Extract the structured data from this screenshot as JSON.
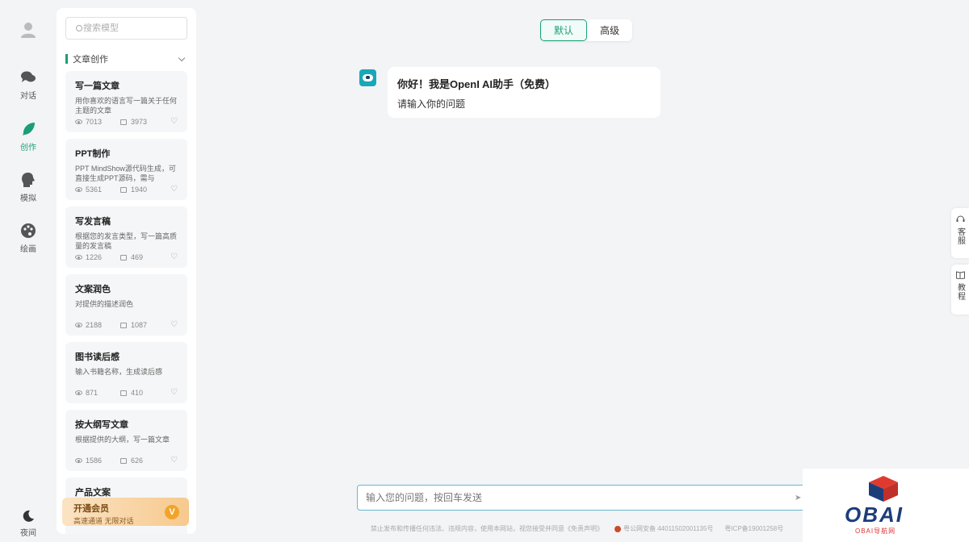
{
  "rail": {
    "items": [
      {
        "label": "对话",
        "icon": "chat-icon"
      },
      {
        "label": "创作",
        "icon": "feather-icon",
        "active": true
      },
      {
        "label": "模拟",
        "icon": "head-icon"
      },
      {
        "label": "绘画",
        "icon": "palette-icon"
      }
    ],
    "night_label": "夜间"
  },
  "sidebar": {
    "search_placeholder": "搜索模型",
    "category": "文章创作",
    "cards": [
      {
        "title": "写一篇文章",
        "desc": "用你喜欢的语言写一篇关于任何主题的文章",
        "views": "7013",
        "comments": "3973"
      },
      {
        "title": "PPT制作",
        "desc": "PPT MindShow源代码生成，可直接生成PPT源码，需与MindShow",
        "views": "5361",
        "comments": "1940"
      },
      {
        "title": "写发言稿",
        "desc": "根据您的发言类型，写一篇高质量的发言稿",
        "views": "1226",
        "comments": "469"
      },
      {
        "title": "文案润色",
        "desc": "对提供的描述润色",
        "views": "2188",
        "comments": "1087"
      },
      {
        "title": "图书读后感",
        "desc": "输入书籍名称，生成读后感",
        "views": "871",
        "comments": "410"
      },
      {
        "title": "按大纲写文章",
        "desc": "根据提供的大纲，写一篇文章",
        "views": "1586",
        "comments": "626"
      },
      {
        "title": "产品文案",
        "desc": "",
        "views": "",
        "comments": ""
      }
    ],
    "vip": {
      "title": "开通会员",
      "subtitle": "高速通道 无限对话",
      "badge": "V"
    }
  },
  "mode": {
    "default": "默认",
    "advanced": "高级"
  },
  "chat": {
    "greeting": "你好！我是OpenI AI助手（免费）",
    "prompt": "请输入你的问题"
  },
  "float": {
    "service": "客服",
    "tutorial": "教程"
  },
  "input": {
    "placeholder": "输入您的问题，按回车发送"
  },
  "footer": {
    "notice": "禁止发布和传播任何违法、违规内容，使用本网站，视您接受并同意《免责声明》",
    "police": "粤公网安备 44011502001135号",
    "icp": "粤ICP备19001258号"
  },
  "watermark": {
    "brand": "OBAI",
    "sub": "OBAI导航网"
  },
  "colors": {
    "accent": "#1a9f78",
    "vip": "#f7c98e"
  }
}
